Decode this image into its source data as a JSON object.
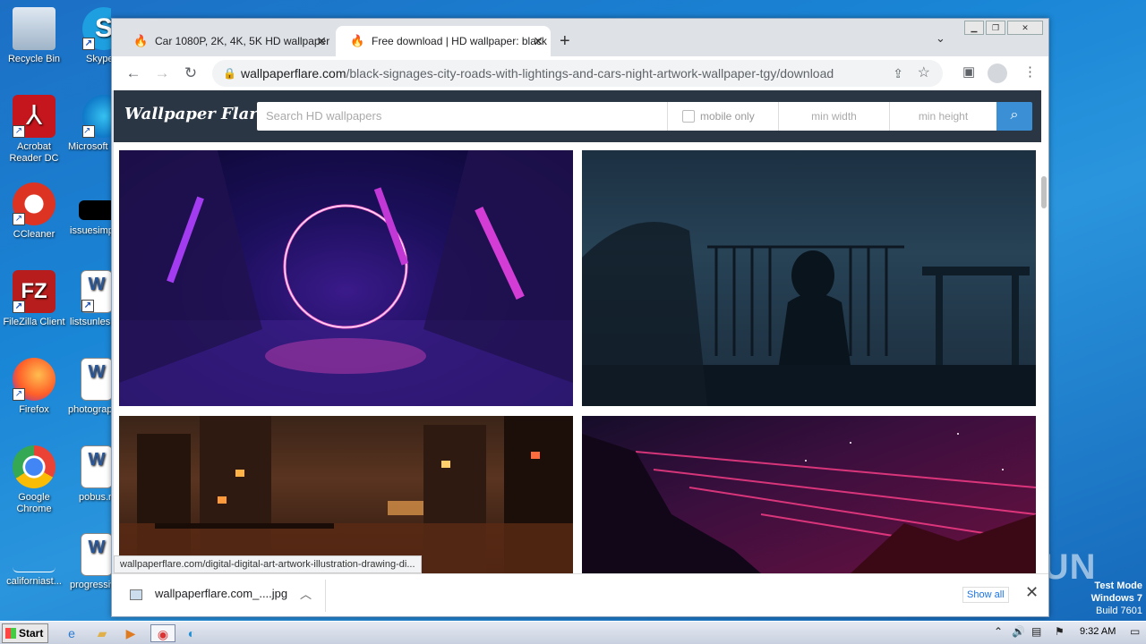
{
  "desktop": {
    "icons": [
      {
        "label": "Recycle Bin",
        "glyph": "🗑"
      },
      {
        "label": "Skype",
        "glyph": "S"
      },
      {
        "label": "Acrobat Reader DC",
        "glyph": "A"
      },
      {
        "label": "Microsoft",
        "glyph": "e"
      },
      {
        "label": "CCleaner",
        "glyph": "C"
      },
      {
        "label": "issuesimp",
        "glyph": ""
      },
      {
        "label": "FileZilla Client",
        "glyph": "FZ"
      },
      {
        "label": "listsunles",
        "glyph": "W"
      },
      {
        "label": "Firefox",
        "glyph": "🦊"
      },
      {
        "label": "photograp",
        "glyph": "W"
      },
      {
        "label": "Google Chrome",
        "glyph": "◉"
      },
      {
        "label": "pobus.r",
        "glyph": "W"
      },
      {
        "label": "californiast...",
        "glyph": ""
      },
      {
        "label": "progressiv",
        "glyph": "W"
      }
    ]
  },
  "browser": {
    "tabs": [
      {
        "title": "Car 1080P, 2K, 4K, 5K HD wallpaper",
        "active": false
      },
      {
        "title": "Free download | HD wallpaper: black",
        "active": true
      }
    ],
    "new_tab": "+",
    "tab_dropdown": "⌄",
    "url_domain": "wallpaperflare.com",
    "url_path": "/black-signages-city-roads-with-lightings-and-cars-night-artwork-wallpaper-tgy/download",
    "status_url": "wallpaperflare.com/digital-digital-art-artwork-illustration-drawing-di...",
    "download": {
      "filename": "wallpaperflare.com_....jpg",
      "show_all": "Show all"
    }
  },
  "site": {
    "logo": "Wallpaper Flare",
    "search_placeholder": "Search HD wallpapers",
    "mobile_only": "mobile only",
    "min_width": "min width",
    "min_height": "min height"
  },
  "taskbar": {
    "start": "Start",
    "clock": "9:32 AM"
  },
  "watermark": {
    "brand": "ANY RUN",
    "test_mode": "Test Mode",
    "os": "Windows 7",
    "build": "Build 7601"
  }
}
